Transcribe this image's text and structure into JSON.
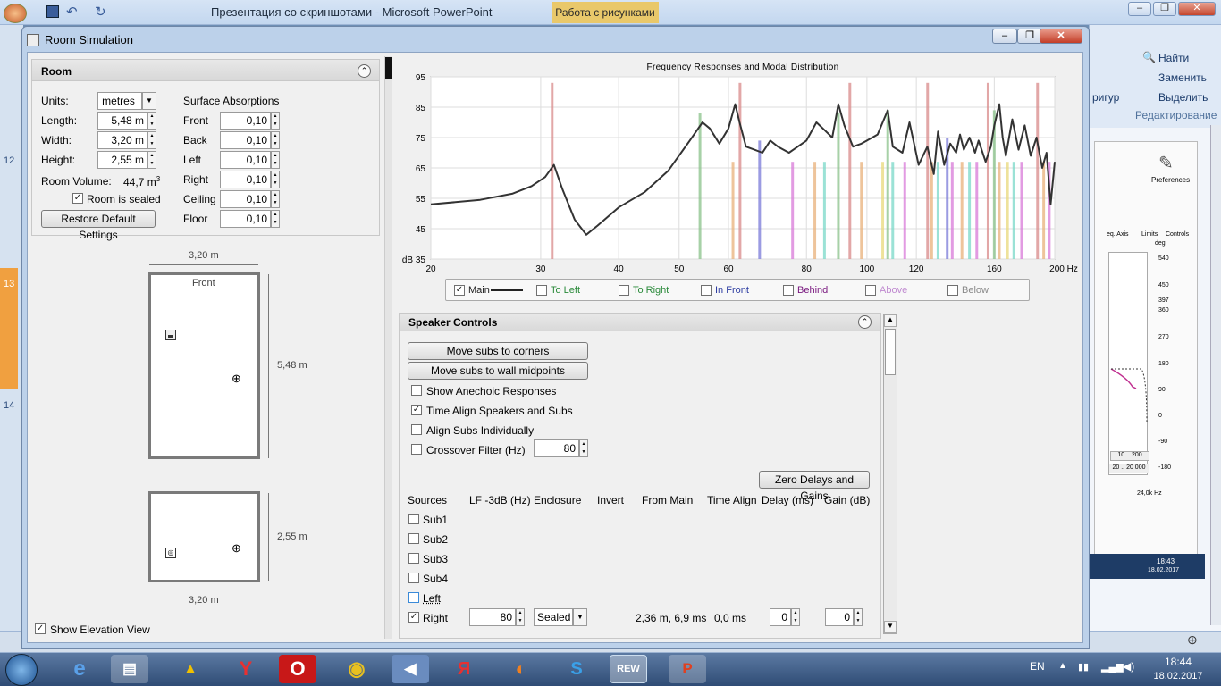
{
  "ppt": {
    "title": "Презентация со скриншотами - Microsoft PowerPoint",
    "context_tab": "Работа с рисунками",
    "ribbon_find": "Найти",
    "ribbon_replace": "Заменить",
    "ribbon_select": "Выделить",
    "ribbon_group": "Редактирование",
    "ribbon_frag": "ригур",
    "left_nums": [
      "12",
      "13",
      "14"
    ],
    "status_date": "18.02.2017"
  },
  "rew_side": {
    "preferences": "Preferences",
    "eq_axis": "eq. Axis",
    "limits": "Limits",
    "controls": "Controls",
    "deg": "deg",
    "scale": [
      "540",
      "450",
      "397",
      "360",
      "270",
      "180",
      "90",
      "0",
      "-90",
      "-180"
    ],
    "range1": "10 .. 200",
    "range2": "20 .. 20 000",
    "khz": "24,0k Hz",
    "time": "18:43",
    "date": "18.02.2017"
  },
  "window": {
    "title": "Room Simulation"
  },
  "room": {
    "header": "Room",
    "units_label": "Units:",
    "units_value": "metres",
    "length_label": "Length:",
    "length_value": "5,48 m",
    "width_label": "Width:",
    "width_value": "3,20 m",
    "height_label": "Height:",
    "height_value": "2,55 m",
    "volume_label": "Room Volume:",
    "volume_value": "44,7 m",
    "volume_sup": "3",
    "sealed_label": "Room is sealed",
    "restore_button": "Restore Default Settings",
    "surface_header": "Surface Absorptions",
    "surfaces": [
      {
        "name": "Front",
        "value": "0,10"
      },
      {
        "name": "Back",
        "value": "0,10"
      },
      {
        "name": "Left",
        "value": "0,10"
      },
      {
        "name": "Right",
        "value": "0,10"
      },
      {
        "name": "Ceiling",
        "value": "0,10"
      },
      {
        "name": "Floor",
        "value": "0,10"
      }
    ]
  },
  "plan": {
    "width_top": "3,20 m",
    "front_label": "Front",
    "length_side": "5,48 m",
    "height_side": "2,55 m",
    "width_bottom": "3,20 m",
    "elevation_label": "Show Elevation View"
  },
  "chart_data": {
    "type": "line",
    "title": "Frequency Responses and Modal Distribution",
    "ylabel": "dB",
    "xscale": "log",
    "xlim": [
      20,
      200
    ],
    "ylim": [
      35,
      95
    ],
    "xunit": "Hz",
    "xticks": [
      "20",
      "30",
      "40",
      "50",
      "60",
      "80",
      "100",
      "120",
      "160",
      "200 Hz"
    ],
    "yticks": [
      "95",
      "85",
      "75",
      "65",
      "55",
      "45",
      "dB 35"
    ],
    "grid": true,
    "series": [
      {
        "name": "Main",
        "color": "#333333",
        "x": [
          20,
          24,
          27,
          29,
          30.5,
          31.5,
          32.5,
          34,
          35.5,
          37,
          40,
          44,
          48,
          52,
          54.5,
          56,
          58,
          60,
          61.5,
          62.5,
          64,
          66,
          68,
          70,
          72,
          75,
          80,
          83,
          85,
          88,
          90,
          92,
          95,
          98,
          100,
          104,
          106,
          108,
          110,
          114,
          117,
          121,
          125,
          128,
          130,
          133,
          136,
          139,
          141,
          143,
          146,
          149,
          151,
          155,
          158,
          160,
          163,
          165,
          167,
          171,
          175,
          179,
          183,
          187,
          191,
          194,
          197,
          200
        ],
        "y": [
          53,
          54.5,
          56.5,
          59,
          62,
          66,
          58,
          48,
          43,
          46,
          52,
          57,
          64,
          74,
          80,
          78,
          73,
          78,
          86,
          80,
          72,
          71,
          70,
          74,
          72,
          70,
          74,
          80,
          78,
          75,
          86,
          79,
          72,
          73,
          74,
          76,
          80,
          84,
          72,
          70,
          80,
          66,
          72,
          63,
          77,
          66,
          73,
          70,
          76,
          71,
          75,
          70,
          74,
          67,
          72,
          79,
          86,
          75,
          69,
          81,
          71,
          79,
          69,
          75,
          65,
          70,
          53,
          67
        ]
      },
      {
        "name": "To Left",
        "color": "#4a9f5a"
      },
      {
        "name": "To Right",
        "color": "#4a9f5a"
      },
      {
        "name": "In Front",
        "color": "#3a46b0"
      },
      {
        "name": "Behind",
        "color": "#8a2a90"
      },
      {
        "name": "Above",
        "color": "#c79ad8"
      },
      {
        "name": "Below",
        "color": "#9a9a9a"
      }
    ],
    "modes": [
      {
        "f": 31.3,
        "level": 93,
        "color": "#d88a8a"
      },
      {
        "f": 54.0,
        "level": 83,
        "color": "#8ac28a"
      },
      {
        "f": 61.0,
        "level": 67,
        "color": "#e8b07a"
      },
      {
        "f": 62.6,
        "level": 93,
        "color": "#d88a8a"
      },
      {
        "f": 67.3,
        "level": 74,
        "color": "#7a7ad8"
      },
      {
        "f": 76.0,
        "level": 67,
        "color": "#d87ad8"
      },
      {
        "f": 82.5,
        "level": 67,
        "color": "#e8b07a"
      },
      {
        "f": 85.5,
        "level": 67,
        "color": "#7ad8c8"
      },
      {
        "f": 90.0,
        "level": 83,
        "color": "#8ac28a"
      },
      {
        "f": 93.9,
        "level": 93,
        "color": "#d88a8a"
      },
      {
        "f": 98.0,
        "level": 67,
        "color": "#e8b07a"
      },
      {
        "f": 106.0,
        "level": 67,
        "color": "#e8d87a"
      },
      {
        "f": 108.0,
        "level": 84,
        "color": "#8ac28a"
      },
      {
        "f": 110.0,
        "level": 67,
        "color": "#7ad8c8"
      },
      {
        "f": 115.0,
        "level": 67,
        "color": "#d87ad8"
      },
      {
        "f": 125.1,
        "level": 93,
        "color": "#d88a8a"
      },
      {
        "f": 127.0,
        "level": 67,
        "color": "#e8b07a"
      },
      {
        "f": 130.0,
        "level": 67,
        "color": "#7ad8c8"
      },
      {
        "f": 134.5,
        "level": 75,
        "color": "#7a7ad8"
      },
      {
        "f": 137.0,
        "level": 67,
        "color": "#d87ad8"
      },
      {
        "f": 142.0,
        "level": 67,
        "color": "#e8b07a"
      },
      {
        "f": 146.0,
        "level": 67,
        "color": "#7ad8c8"
      },
      {
        "f": 150.0,
        "level": 67,
        "color": "#d87ad8"
      },
      {
        "f": 156.4,
        "level": 93,
        "color": "#d88a8a"
      },
      {
        "f": 160.0,
        "level": 84,
        "color": "#8ac28a"
      },
      {
        "f": 163.0,
        "level": 67,
        "color": "#e8b07a"
      },
      {
        "f": 168.0,
        "level": 67,
        "color": "#e8d87a"
      },
      {
        "f": 172.0,
        "level": 67,
        "color": "#7ad8c8"
      },
      {
        "f": 177.0,
        "level": 67,
        "color": "#d87ad8"
      },
      {
        "f": 187.7,
        "level": 93,
        "color": "#d88a8a"
      },
      {
        "f": 192.0,
        "level": 67,
        "color": "#e8b07a"
      },
      {
        "f": 196.0,
        "level": 67,
        "color": "#d87ad8"
      }
    ]
  },
  "legend": [
    {
      "label": "Main",
      "checked": true,
      "color": "#222222"
    },
    {
      "label": "To Left",
      "checked": false,
      "color": "#2a8a3a"
    },
    {
      "label": "To Right",
      "checked": false,
      "color": "#2a8a3a"
    },
    {
      "label": "In Front",
      "checked": false,
      "color": "#2a3aa0"
    },
    {
      "label": "Behind",
      "checked": false,
      "color": "#7a1a80"
    },
    {
      "label": "Above",
      "checked": false,
      "color": "#c08ad0"
    },
    {
      "label": "Below",
      "checked": false,
      "color": "#8a8a8a"
    }
  ],
  "speaker": {
    "header": "Speaker Controls",
    "corners_button": "Move subs to corners",
    "midpoints_button": "Move subs to wall midpoints",
    "anechoic_label": "Show Anechoic Responses",
    "timealign_label": "Time Align Speakers and Subs",
    "alignsubs_label": "Align Subs Individually",
    "crossover_label": "Crossover Filter (Hz)",
    "crossover_value": "80",
    "zero_button": "Zero Delays and Gains",
    "columns": [
      "Sources",
      "LF -3dB (Hz)",
      "Enclosure",
      "Invert",
      "From Main",
      "Time Align",
      "Delay (ms)",
      "Gain (dB)"
    ],
    "sources": [
      "Sub1",
      "Sub2",
      "Sub3",
      "Sub4",
      "Left",
      "Right"
    ],
    "right_lf": "80",
    "right_enclosure": "Sealed",
    "right_from_main": "2,36 m, 6,9 ms",
    "right_time_align": "0,0 ms",
    "right_delay": "0",
    "right_gain": "0"
  },
  "taskbar": {
    "lang": "EN",
    "time": "18:44",
    "date": "18.02.2017",
    "rew_label": "REW"
  }
}
